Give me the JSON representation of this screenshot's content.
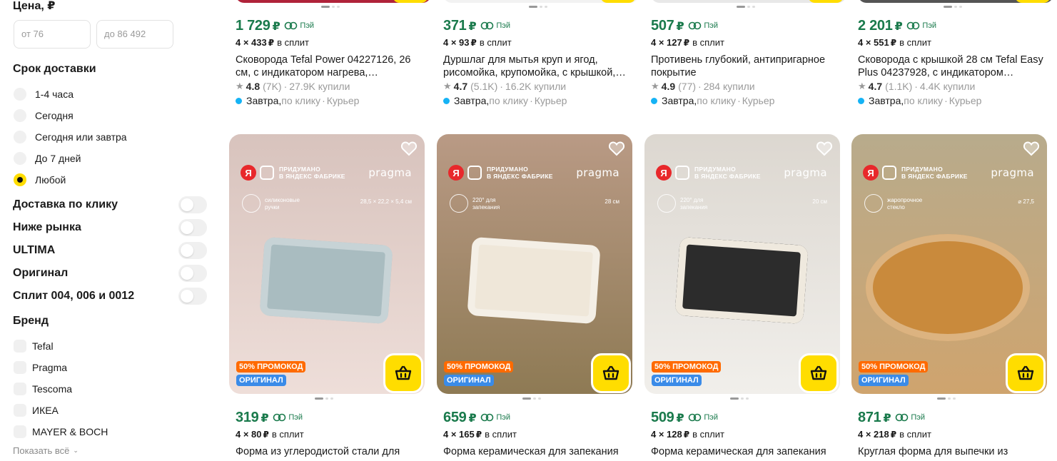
{
  "sidebar": {
    "price": {
      "title": "Цена, ₽",
      "from_placeholder": "от 76",
      "to_placeholder": "до 86 492"
    },
    "delivery_time": {
      "title": "Срок доставки",
      "options": [
        {
          "label": "1-4 часа",
          "selected": false
        },
        {
          "label": "Сегодня",
          "selected": false
        },
        {
          "label": "Сегодня или завтра",
          "selected": false
        },
        {
          "label": "До 7 дней",
          "selected": false
        },
        {
          "label": "Любой",
          "selected": true
        }
      ]
    },
    "toggles": [
      {
        "label": "Доставка по клику",
        "on": false
      },
      {
        "label": "Ниже рынка",
        "on": false
      },
      {
        "label": "ULTIMA",
        "on": false
      },
      {
        "label": "Оригинал",
        "on": false
      },
      {
        "label": "Сплит 004, 006 и 0012",
        "on": false
      }
    ],
    "brand": {
      "title": "Бренд",
      "items": [
        "Tefal",
        "Pragma",
        "Tescoma",
        "ИКЕА",
        "MAYER & BOCH"
      ],
      "show_all": "Показать всё"
    }
  },
  "common": {
    "currency": "₽",
    "pay_label": "Пэй",
    "split_suffix": "в сплит",
    "promo_badge": "50% ПРОМОКОД",
    "original_badge": "ОРИГИНАЛ",
    "fabrika_line1": "ПРИДУМАНО",
    "fabrika_line2": "В ЯНДЕКС ФАБРИКЕ",
    "brand_mark": "pragma",
    "delivery_day": "Завтра",
    "delivery_mode": "по клику",
    "delivery_carrier": "Курьер"
  },
  "top_row": [
    {
      "price": "1 729",
      "split": "4 × 433",
      "title": "Сковорода Tefal Power 04227126, 26 см, с индикатором нагрева,…",
      "rating": "4.8",
      "reviews": "(7K)",
      "bought": "27.9K купили"
    },
    {
      "price": "371",
      "split": "4 × 93",
      "title": "Дуршлаг для мытья круп и ягод, рисомойка, крупомойка, с крышкой,…",
      "rating": "4.7",
      "reviews": "(5.1K)",
      "bought": "16.2K купили"
    },
    {
      "price": "507",
      "split": "4 × 127",
      "title": "Противень глубокий, антипригарное покрытие",
      "rating": "4.9",
      "reviews": "(77)",
      "bought": "284 купили"
    },
    {
      "price": "2 201",
      "split": "4 × 551",
      "title": "Сковорода с крышкой 28 см Tefal Easy Plus 04237928, с индикатором…",
      "rating": "4.7",
      "reviews": "(1.1K)",
      "bought": "4.4K купили"
    }
  ],
  "bottom_row": [
    {
      "price": "319",
      "split": "4 × 80",
      "title": "Форма из углеродистой стали для",
      "feature": "силиконовые ручки",
      "size": "28,5 × 22,2 × 5,4 см",
      "bg_top": "#d8c3bd",
      "bg_bottom": "#eeded9"
    },
    {
      "price": "659",
      "split": "4 × 165",
      "title": "Форма керамическая для запекания",
      "feature": "220° для запекания",
      "size": "28 см",
      "bg_top": "#b99a85",
      "bg_bottom": "#8e7a54"
    },
    {
      "price": "509",
      "split": "4 × 128",
      "title": "Форма керамическая для запекания",
      "feature": "220° для запекания",
      "size": "20 см",
      "bg_top": "#dcd7d0",
      "bg_bottom": "#f1efeb"
    },
    {
      "price": "871",
      "split": "4 × 218",
      "title": "Круглая форма для выпечки из",
      "feature": "жаропрочное стекло",
      "size": "⌀ 27,5",
      "bg_top": "#b8ab8c",
      "bg_bottom": "#cfa46e"
    }
  ]
}
